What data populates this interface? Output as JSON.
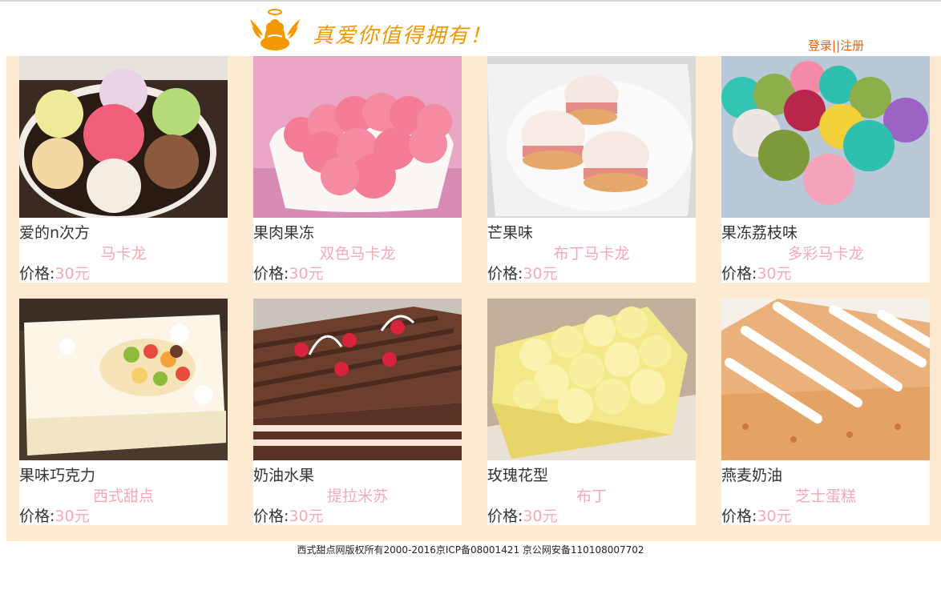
{
  "header": {
    "slogan": "真爱你值得拥有！",
    "login": "登录",
    "separator": "||",
    "register": "注册"
  },
  "products": [
    {
      "name": "爱的n次方",
      "category": "马卡龙",
      "price_label": "价格:",
      "price": "30元",
      "image": "macarons-in-round-box"
    },
    {
      "name": "果肉果冻",
      "category": "双色马卡龙",
      "price_label": "价格:",
      "price": "30元",
      "image": "pink-macarons-in-white-dish"
    },
    {
      "name": "芒果味",
      "category": "布丁马卡龙",
      "price_label": "价格:",
      "price": "30元",
      "image": "iced-pastries-on-plate"
    },
    {
      "name": "果冻荔枝味",
      "category": "多彩马卡龙",
      "price_label": "价格:",
      "price": "30元",
      "image": "colorful-macarons-in-tray"
    },
    {
      "name": "果味巧克力",
      "category": "西式甜点",
      "price_label": "价格:",
      "price": "30元",
      "image": "fruit-cream-cake"
    },
    {
      "name": "奶油水果",
      "category": "提拉米苏",
      "price_label": "价格:",
      "price": "30元",
      "image": "chocolate-layer-cake"
    },
    {
      "name": "玫瑰花型",
      "category": "布丁",
      "price_label": "价格:",
      "price": "30元",
      "image": "rose-cream-cake"
    },
    {
      "name": "燕麦奶油",
      "category": "芝士蛋糕",
      "price_label": "价格:",
      "price": "30元",
      "image": "oat-cream-cake"
    }
  ],
  "footer": {
    "text": "西式甜点网版权所有2000-2016京ICP备08001421  京公网安备110108007702"
  },
  "colors": {
    "accent_orange": "#f39800",
    "link_orange": "#e8620c",
    "category_pink": "#f7a9b6",
    "panel_bg": "#feead0"
  }
}
